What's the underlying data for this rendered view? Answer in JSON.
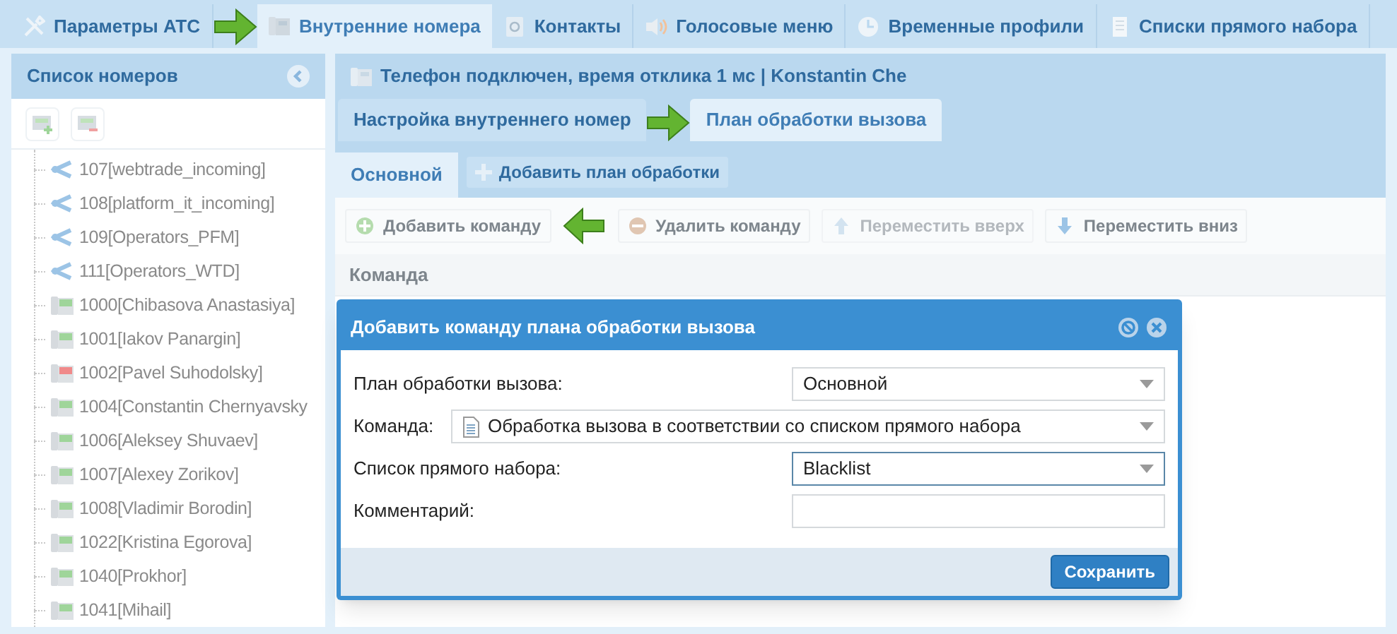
{
  "top_tabs": [
    {
      "label": "Параметры АТС",
      "selected": false
    },
    {
      "label": "Внутренние номера",
      "selected": true
    },
    {
      "label": "Контакты",
      "selected": false
    },
    {
      "label": "Голосовые меню",
      "selected": false
    },
    {
      "label": "Временные профили",
      "selected": false
    },
    {
      "label": "Списки прямого набора",
      "selected": false
    }
  ],
  "number_list": {
    "title": "Список номеров",
    "items": [
      {
        "label": "107[webtrade_incoming]",
        "kind": "group"
      },
      {
        "label": "108[platform_it_incoming]",
        "kind": "group"
      },
      {
        "label": "109[Operators_PFM]",
        "kind": "group"
      },
      {
        "label": "111[Operators_WTD]",
        "kind": "group"
      },
      {
        "label": "1000[Chibasova Anastasiya]",
        "kind": "phone",
        "color": "#9fd59a"
      },
      {
        "label": "1001[Iakov Panargin]",
        "kind": "phone",
        "color": "#9fd59a"
      },
      {
        "label": "1002[Pavel Suhodolsky]",
        "kind": "phone",
        "color": "#f08a8a"
      },
      {
        "label": "1004[Constantin Chernyavsky",
        "kind": "phone",
        "color": "#9fd59a"
      },
      {
        "label": "1006[Aleksey Shuvaev]",
        "kind": "phone",
        "color": "#9fd59a"
      },
      {
        "label": "1007[Alexey Zorikov]",
        "kind": "phone",
        "color": "#9fd59a"
      },
      {
        "label": "1008[Vladimir Borodin]",
        "kind": "phone",
        "color": "#9fd59a"
      },
      {
        "label": "1022[Kristina Egorova]",
        "kind": "phone",
        "color": "#9fd59a"
      },
      {
        "label": "1040[Prokhor]",
        "kind": "phone",
        "color": "#9fd59a"
      },
      {
        "label": "1041[Mihail]",
        "kind": "phone",
        "color": "#9fd59a"
      }
    ]
  },
  "status_header": "Телефон подключен, время отклика 1 мс | Konstantin Che",
  "sub_tabs": [
    {
      "label": "Настройка внутреннего номер",
      "selected": false
    },
    {
      "label": "План обработки вызова",
      "selected": true
    }
  ],
  "plan_tabs": [
    {
      "label": "Основной",
      "selected": true
    }
  ],
  "add_plan_button": "Добавить план обработки",
  "toolbar": [
    {
      "label": "Добавить команду",
      "disabled": false
    },
    {
      "label": "Удалить команду",
      "disabled": false
    },
    {
      "label": "Переместить вверх",
      "disabled": true
    },
    {
      "label": "Переместить вниз",
      "disabled": false
    }
  ],
  "table": {
    "columns": [
      "Команда"
    ]
  },
  "dialog": {
    "title": "Добавить команду плана обработки вызова",
    "fields": [
      {
        "label": "План обработки вызова:",
        "kind": "select",
        "value": "Основной",
        "focused": false
      },
      {
        "label": "Команда:",
        "kind": "select_icon",
        "value": "Обработка вызова в соответствии со списком прямого набора",
        "focused": false
      },
      {
        "label": "Список прямого набора:",
        "kind": "select",
        "value": "Blacklist",
        "focused": true
      },
      {
        "label": "Комментарий:",
        "kind": "text",
        "focused": false
      }
    ],
    "save_button": "Сохранить"
  }
}
